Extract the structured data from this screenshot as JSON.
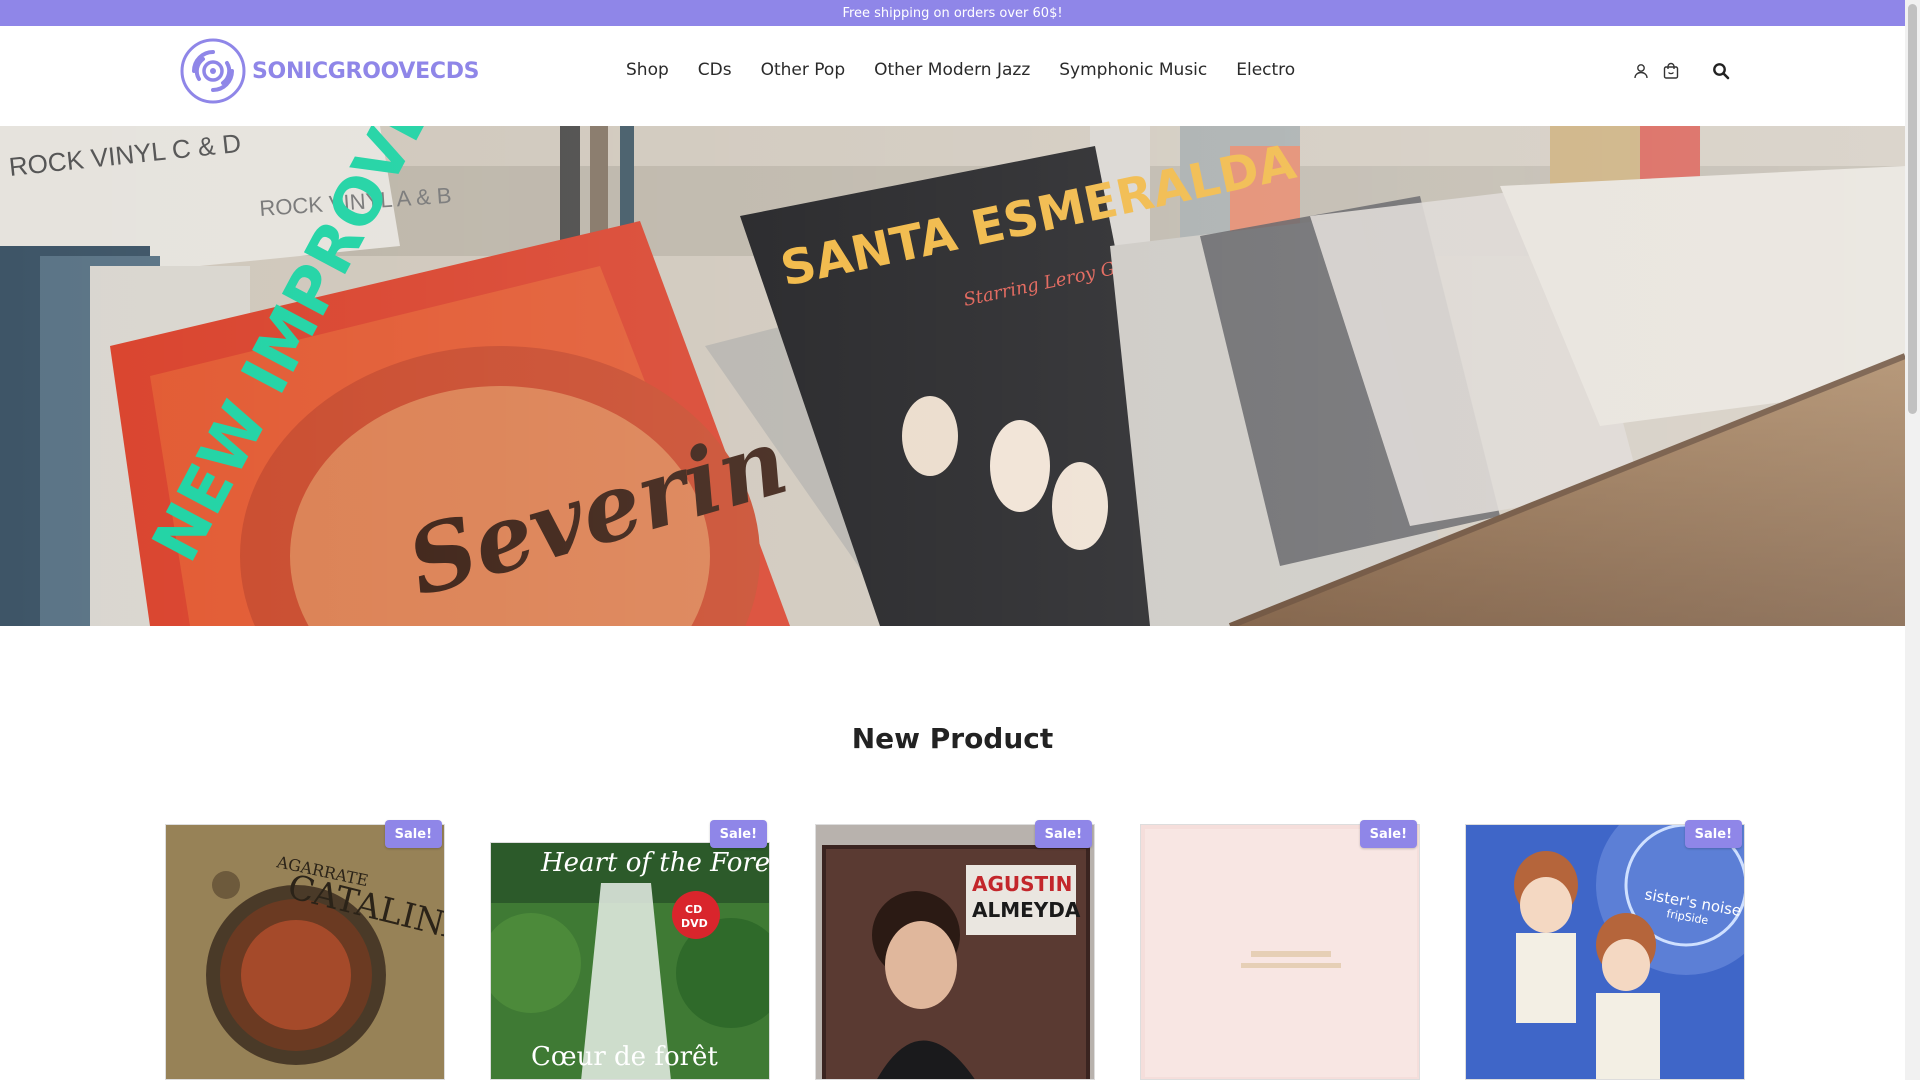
{
  "announcement": {
    "text": "Free shipping on orders over 60$!"
  },
  "header": {
    "logo_text": "SONICGROOVECDS",
    "nav": [
      "Shop",
      "CDs",
      "Other Pop",
      "Other Modern Jazz",
      "Symphonic Music",
      "Electro"
    ],
    "icons": [
      "user-icon",
      "cart-icon",
      "search-icon"
    ]
  },
  "hero": {
    "bin_labels": [
      "ROCK VINYL C & D",
      "ROCK VINYL A & B"
    ],
    "record_texts": [
      "NEW IMPROVED",
      "Severin",
      "SANTA ESMERALDA",
      "Starring Leroy Gomez"
    ]
  },
  "section": {
    "title": "New Product"
  },
  "products": [
    {
      "badge": "Sale!",
      "cover_text": "AGARRATE CATALINA"
    },
    {
      "badge": "Sale!",
      "cover_text": "Heart of the Forest",
      "cover_sub": "Cœur de forêt",
      "cover_tag": "CD + DVD"
    },
    {
      "badge": "Sale!",
      "cover_text": "AGUSTIN ALMEYDA"
    },
    {
      "badge": "Sale!",
      "cover_text": ""
    },
    {
      "badge": "Sale!",
      "cover_text": "sister's noise",
      "cover_sub": "fripSide"
    }
  ],
  "colors": {
    "brand": "#8f86e8",
    "text": "#2a2a2a",
    "white": "#ffffff"
  }
}
